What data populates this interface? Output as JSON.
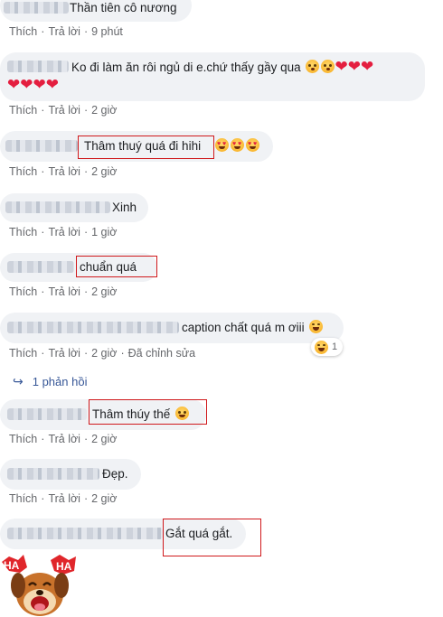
{
  "action_labels": {
    "like": "Thích",
    "reply": "Trả lời",
    "edited": "Đã chỉnh sửa"
  },
  "comments": [
    {
      "text": "Thần tiên cô nương",
      "time": "9 phút"
    },
    {
      "text_line1": "Ko đi làm ăn rôi ngủ di e.chứ thấy gầy qua",
      "time": "2 giờ"
    },
    {
      "text": "Thâm thuý quá đi hihi",
      "time": "2 giờ"
    },
    {
      "text": "Xinh",
      "time": "1 giờ"
    },
    {
      "text": "chuẩn quá",
      "time": "2 giờ"
    },
    {
      "text": "caption chất quá m ơiii",
      "time": "2 giờ",
      "reaction_count": "1"
    },
    {
      "text": "Thâm thúy thế",
      "time": "2 giờ"
    },
    {
      "text": "Đẹp.",
      "time": "2 giờ"
    },
    {
      "text": "Gắt quá gắt."
    }
  ],
  "replies_link": "1 phản hồi",
  "sticker": {
    "left_text": "HA",
    "right_text": "HA"
  },
  "colors": {
    "bubble": "#f0f2f5",
    "highlight": "#d0191c",
    "meta": "#65676b",
    "link": "#385898"
  }
}
